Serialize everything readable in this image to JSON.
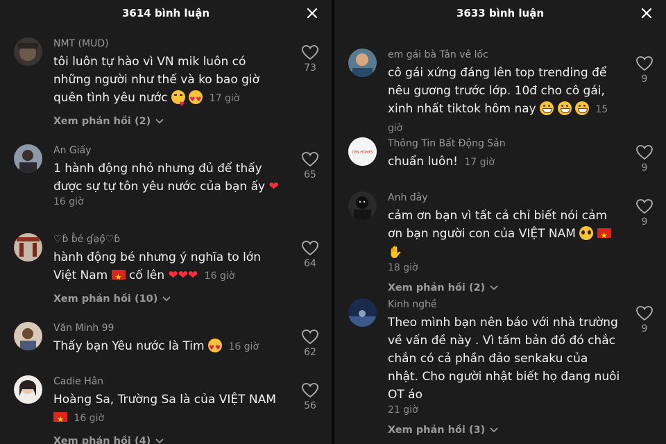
{
  "left": {
    "title": "3614 bình luận",
    "comments": [
      {
        "user": "NMT (MUD)",
        "text": "tôi luôn tự hào vì VN mik luôn có những người như thế và ko bao giờ quên tình yêu nước",
        "time": "17 giờ",
        "likes": "73",
        "replies": "Xem phản hồi (2)"
      },
      {
        "user": "An Giấy",
        "text": "1 hành động nhỏ nhưng đủ để thấy được sự tự tôn yêu nước của bạn ấy",
        "time": "16 giờ",
        "likes": "65"
      },
      {
        "user": "♡ɓ ɓ́é ɠạǫ̂♡ɓ",
        "text": "hành động bé nhưng ý nghĩa to lớn Việt Nam",
        "text2": "cố lên",
        "time": "16 giờ",
        "likes": "64",
        "replies": "Xem phản hồi (10)"
      },
      {
        "user": "Văn Minh 99",
        "text": "Thấy bạn Yêu nước là Tim",
        "time": "16 giờ",
        "likes": "62"
      },
      {
        "user": "Cadie Hân",
        "text": "Hoàng Sa, Trường Sa là của VIỆT NAM",
        "time": "16 giờ",
        "likes": "56",
        "replies": "Xem phản hồi (4)"
      }
    ]
  },
  "right": {
    "title": "3633 bình luận",
    "comments": [
      {
        "user": "em gái bà Tân vê lốc",
        "text": "cô gái xứng đáng lên top trending để nêu gương trước lớp. 10đ cho cô gái, xinh nhất tiktok hôm nay",
        "time": "15 giờ",
        "likes": "9"
      },
      {
        "user": "Thông Tin Bất Động Sản",
        "avatar_text": "CEN HOMES",
        "text": "chuẩn luôn!",
        "time": "17 giờ",
        "likes": "9"
      },
      {
        "user": "Anh đây",
        "text": "cảm ơn bạn vì tất cả chỉ biết nói cảm ơn bạn người con của VIỆT NAM",
        "time": "18 giờ",
        "likes": "9",
        "replies": "Xem phản hồi (2)"
      },
      {
        "user": "Kinh nghề",
        "text": "Theo mình bạn nên báo với nhà trường về vấn đề này . Vì tấm bản đồ đó chắc chắn có cả phần đảo senkaku của nhật. Cho người nhật biết họ đang nuôi OT áo",
        "time": "21 giờ",
        "likes": "9",
        "replies": "Xem phản hồi (3)"
      }
    ]
  },
  "colors": {
    "background": "#1c1c1c",
    "username": "#9a9a9a",
    "text": "#f0f0f0",
    "heart": "#ff2d3f"
  },
  "icons": [
    "close-icon",
    "heart-outline-icon",
    "chevron-down-icon"
  ]
}
